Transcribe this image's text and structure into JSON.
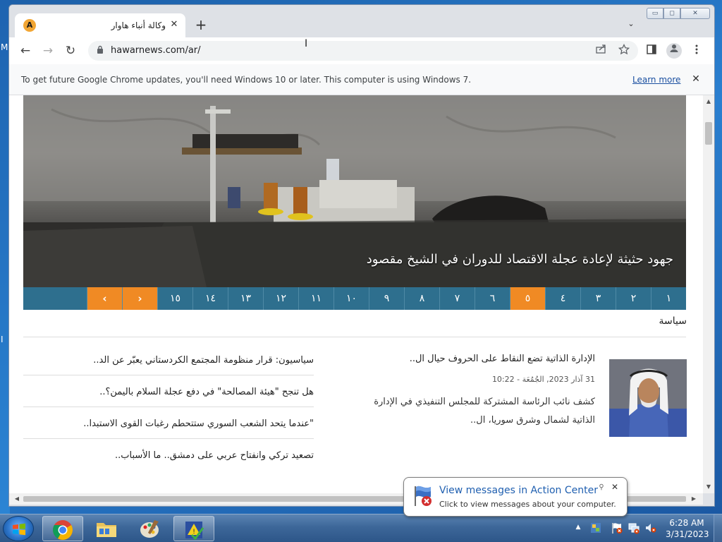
{
  "desktop": {
    "edge_chars": [
      "M",
      "I"
    ]
  },
  "browser": {
    "tab": {
      "favicon_letter": "A",
      "title": "وكالة أنباء هاوار",
      "close": "✕"
    },
    "new_tab": "+",
    "tab_search": "⌄",
    "window": {
      "minimize": "▭",
      "maximize": "◻",
      "close": "✕"
    },
    "nav": {
      "back": "←",
      "forward": "→",
      "reload": "↻"
    },
    "url": "hawarnews.com/ar/",
    "infobar": {
      "text": "To get future Google Chrome updates, you'll need Windows 10 or later. This computer is using Windows 7.",
      "link": "Learn more",
      "close": "✕"
    }
  },
  "page": {
    "hero_caption": "جهود حثيثة لإعادة عجلة الاقتصاد للدوران في الشيخ مقصود",
    "pager": {
      "numbers": [
        "١",
        "٢",
        "٣",
        "٤",
        "٥",
        "٦",
        "٧",
        "٨",
        "٩",
        "١٠",
        "١١",
        "١٢",
        "١٣",
        "١٤",
        "١٥"
      ],
      "active_index": 4,
      "next": "›",
      "prev": "‹"
    },
    "section_title": "سياسة",
    "feature": {
      "title": "الإدارة الذاتية تضع النقاط على الحروف حيال ال..",
      "date": "31 آذار 2023, الجُمُعَة - 10:22",
      "excerpt": "كشف نائب الرئاسة المشتركة للمجلس التنفيذي في الإدارة الذاتية لشمال وشرق سوريا، ال.."
    },
    "headlines": [
      "سياسيون: قرار منظومة المجتمع الكردستاني يعبّر عن الد..",
      "هل تنجح \"هيئة المصالحة\" في دفع عجلة السلام باليمن؟..",
      "\"عندما يتحد الشعب السوري ستتحطم رغبات القوى الاستبدا..",
      "تصعيد تركي وانفتاح عربي على دمشق.. ما الأسباب.."
    ]
  },
  "notification": {
    "title": "View messages in Action Center",
    "text": "Click to view messages about your computer.",
    "close": "✕",
    "pin": "⚲"
  },
  "taskbar": {
    "tray_arrow": "▲",
    "time": "6:28 AM",
    "date": "3/31/2023"
  },
  "colors": {
    "pager_bg": "#2e6f8e",
    "pager_active": "#f08a24",
    "accent": "#1f5fb0"
  }
}
